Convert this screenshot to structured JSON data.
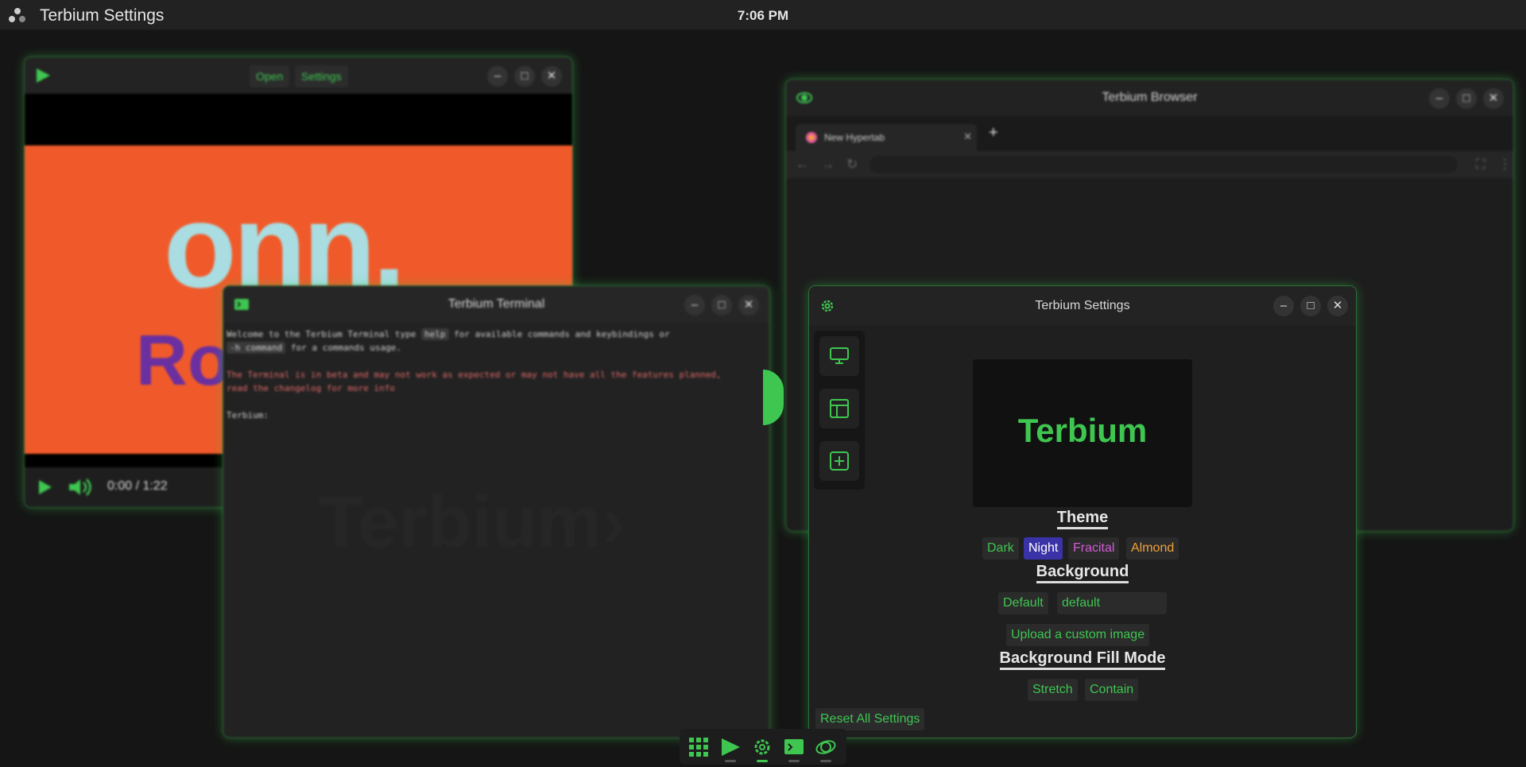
{
  "topbar": {
    "app_title": "Terbium Settings",
    "clock": "7:06 PM"
  },
  "video_window": {
    "open_label": "Open",
    "settings_label": "Settings",
    "time": "0:00 / 1:22",
    "content_text_1": "onn.",
    "content_text_2": "Ro"
  },
  "browser_window": {
    "title": "Terbium Browser",
    "tab_label": "New Hypertab",
    "new_tab_label": "+"
  },
  "terminal_window": {
    "title": "Terbium Terminal",
    "line1_a": "Welcome to the Terbium Terminal type ",
    "line1_kbd": "help",
    "line1_b": " for available commands and keybindings or",
    "line2_kbd": "-h command",
    "line2_b": " for a commands usage.",
    "warning1": "The Terminal is in beta and may not work as expected or may not have all the features planned,",
    "warning2": "read the changelog for more info",
    "prompt": "Terbium:",
    "watermark": "Terbium"
  },
  "settings_window": {
    "title": "Terbium Settings",
    "preview_text": "Terbium",
    "theme_heading": "Theme",
    "themes": [
      {
        "label": "Dark",
        "color": "#3ec651"
      },
      {
        "label": "Night",
        "color": "#ffffff"
      },
      {
        "label": "Fracital",
        "color": "#d45bd6"
      },
      {
        "label": "Almond",
        "color": "#f0a23a"
      }
    ],
    "background_heading": "Background",
    "bg_default_label": "Default",
    "bg_input_value": "default",
    "upload_label": "Upload a custom image",
    "fill_heading": "Background Fill Mode",
    "fill_stretch": "Stretch",
    "fill_contain": "Contain",
    "reset_label": "Reset All Settings"
  },
  "window_controls": {
    "minimize": "–",
    "maximize": "□",
    "close": "✕"
  },
  "colors": {
    "accent": "#3ec651",
    "night_active": "#3a33a8"
  }
}
